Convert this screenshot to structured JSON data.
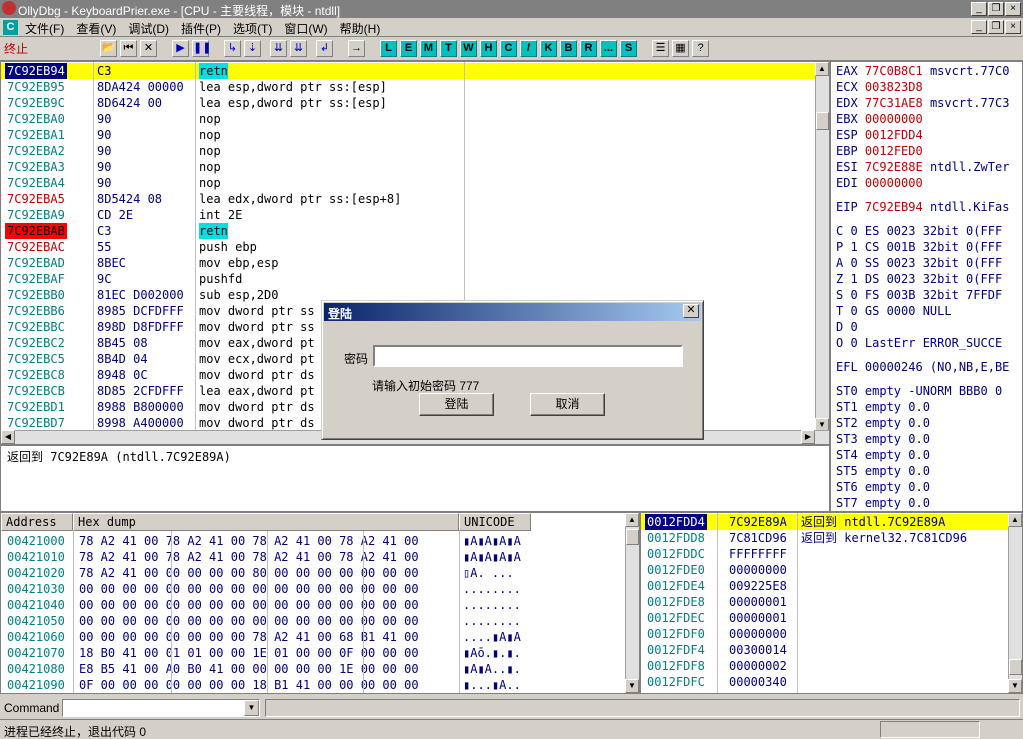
{
  "window": {
    "title": "OllyDbg - KeyboardPrier.exe - [CPU - 主要线程，模块 - ntdll]"
  },
  "menu": [
    "文件(F)",
    "查看(V)",
    "调试(D)",
    "插件(P)",
    "选项(T)",
    "窗口(W)",
    "帮助(H)"
  ],
  "toolbar": {
    "status": "终止",
    "letters": [
      "L",
      "E",
      "M",
      "T",
      "W",
      "H",
      "C",
      "/",
      "K",
      "B",
      "R",
      "...",
      "S"
    ]
  },
  "cpu": {
    "rows": [
      {
        "addr": "7C92EB94",
        "hex": "C3",
        "dis": "retn",
        "style": "sel",
        "hl": true
      },
      {
        "addr": "7C92EB95",
        "hex": "8DA424 00000",
        "dis": "lea esp,dword ptr ss:[esp]"
      },
      {
        "addr": "7C92EB9C",
        "hex": "8D6424 00",
        "dis": "lea esp,dword ptr ss:[esp]"
      },
      {
        "addr": "7C92EBA0",
        "hex": "90",
        "dis": "nop"
      },
      {
        "addr": "7C92EBA1",
        "hex": "90",
        "dis": "nop"
      },
      {
        "addr": "7C92EBA2",
        "hex": "90",
        "dis": "nop"
      },
      {
        "addr": "7C92EBA3",
        "hex": "90",
        "dis": "nop"
      },
      {
        "addr": "7C92EBA4",
        "hex": "90",
        "dis": "nop"
      },
      {
        "addr": "7C92EBA5",
        "hex": "8D5424 08",
        "dis": "lea edx,dword ptr ss:[esp+8]",
        "style": "red"
      },
      {
        "addr": "7C92EBA9",
        "hex": "CD 2E",
        "dis": "int 2E"
      },
      {
        "addr": "7C92EBAB",
        "hex": "C3",
        "dis": "retn",
        "style": "bp",
        "hl": true
      },
      {
        "addr": "7C92EBAC",
        "hex": "55",
        "dis": "push ebp",
        "style": "red"
      },
      {
        "addr": "7C92EBAD",
        "hex": "8BEC",
        "dis": "mov ebp,esp"
      },
      {
        "addr": "7C92EBAF",
        "hex": "9C",
        "dis": "pushfd"
      },
      {
        "addr": "7C92EBB0",
        "hex": "81EC D002000",
        "dis": "sub esp,2D0"
      },
      {
        "addr": "7C92EBB6",
        "hex": "8985 DCFDFFF",
        "dis": "mov dword ptr ss"
      },
      {
        "addr": "7C92EBBC",
        "hex": "898D D8FDFFF",
        "dis": "mov dword ptr ss"
      },
      {
        "addr": "7C92EBC2",
        "hex": "8B45 08",
        "dis": "mov eax,dword pt"
      },
      {
        "addr": "7C92EBC5",
        "hex": "8B4D 04",
        "dis": "mov ecx,dword pt"
      },
      {
        "addr": "7C92EBC8",
        "hex": "8948 0C",
        "dis": "mov dword ptr ds"
      },
      {
        "addr": "7C92EBCB",
        "hex": "8D85 2CFDFFF",
        "dis": "lea eax,dword pt"
      },
      {
        "addr": "7C92EBD1",
        "hex": "8988 B800000",
        "dis": "mov dword ptr ds"
      },
      {
        "addr": "7C92EBD7",
        "hex": "8998 A400000",
        "dis": "mov dword ptr ds"
      }
    ]
  },
  "info": {
    "line": "返回到 7C92E89A (ntdll.7C92E89A)"
  },
  "registers": [
    {
      "n": "EAX",
      "v": "77C0B8C1",
      "c": "msvcrt.77C0"
    },
    {
      "n": "ECX",
      "v": "003823D8",
      "c": ""
    },
    {
      "n": "EDX",
      "v": "77C31AE8",
      "c": "msvcrt.77C3"
    },
    {
      "n": "EBX",
      "v": "00000000",
      "c": ""
    },
    {
      "n": "ESP",
      "v": "0012FDD4",
      "c": ""
    },
    {
      "n": "EBP",
      "v": "0012FED0",
      "c": ""
    },
    {
      "n": "ESI",
      "v": "7C92E88E",
      "c": "ntdll.ZwTer"
    },
    {
      "n": "EDI",
      "v": "00000000",
      "c": ""
    },
    {
      "n": "EIP",
      "v": "7C92EB94",
      "c": "ntdll.KiFas"
    }
  ],
  "flags": [
    "C 0  ES 0023 32bit 0(FFF",
    "P 1  CS 001B 32bit 0(FFF",
    "A 0  SS 0023 32bit 0(FFF",
    "Z 1  DS 0023 32bit 0(FFF",
    "S 0  FS 003B 32bit 7FFDF",
    "T 0  GS 0000 NULL",
    "D 0",
    "O 0  LastErr ERROR_SUCCE"
  ],
  "efl": "EFL 00000246 (NO,NB,E,BE",
  "fpu": [
    "ST0 empty -UNORM BBB0 0",
    "ST1 empty 0.0",
    "ST2 empty 0.0",
    "ST3 empty 0.0",
    "ST4 empty 0.0",
    "ST5 empty 0.0",
    "ST6 empty 0.0",
    "ST7 empty 0.0"
  ],
  "dump": {
    "headers": [
      "Address",
      "Hex dump",
      "UNICODE"
    ],
    "rows": [
      {
        "a": "00421000",
        "h": "78 A2 41 00|78 A2 41 00|78 A2 41 00|78 A2 41 00",
        "u": "▮A▮A▮A▮A"
      },
      {
        "a": "00421010",
        "h": "78 A2 41 00|78 A2 41 00|78 A2 41 00|78 A2 41 00",
        "u": "▮A▮A▮A▮A"
      },
      {
        "a": "00421020",
        "h": "78 A2 41 00|00 00 00 00|80 00 00 00|00 00 00 00",
        "u": "▯A.  ..."
      },
      {
        "a": "00421030",
        "h": "00 00 00 00|00 00 00 00|00 00 00 00|00 00 00 00",
        "u": "........"
      },
      {
        "a": "00421040",
        "h": "00 00 00 00|00 00 00 00|00 00 00 00|00 00 00 00",
        "u": "........"
      },
      {
        "a": "00421050",
        "h": "00 00 00 00|00 00 00 00|00 00 00 00|00 00 00 00",
        "u": "........"
      },
      {
        "a": "00421060",
        "h": "00 00 00 00|00 00 00 00|78 A2 41 00|68 B1 41 00",
        "u": "....▮A▮A"
      },
      {
        "a": "00421070",
        "h": "18 B0 41 00|01 01 00 00|1E 01 00 00|0F 00 00 00",
        "u": "▮Aō.▮.▮."
      },
      {
        "a": "00421080",
        "h": "E8 B5 41 00|A0 B0 41 00|00 00 00 00|1E 00 00 00",
        "u": "▮A▮A..▮."
      },
      {
        "a": "00421090",
        "h": "0F 00 00 00|00 00 00 00|18 B1 41 00|00 00 00 00",
        "u": "▮...▮A.."
      }
    ]
  },
  "stack": {
    "rows": [
      {
        "a": "0012FDD4",
        "v": "7C92E89A",
        "c": "返回到 ntdll.7C92E89A",
        "sel": true
      },
      {
        "a": "0012FDD8",
        "v": "7C81CD96",
        "c": "返回到 kernel32.7C81CD96"
      },
      {
        "a": "0012FDDC",
        "v": "FFFFFFFF",
        "c": ""
      },
      {
        "a": "0012FDE0",
        "v": "00000000",
        "c": ""
      },
      {
        "a": "0012FDE4",
        "v": "009225E8",
        "c": ""
      },
      {
        "a": "0012FDE8",
        "v": "00000001",
        "c": ""
      },
      {
        "a": "0012FDEC",
        "v": "00000001",
        "c": ""
      },
      {
        "a": "0012FDF0",
        "v": "00000000",
        "c": ""
      },
      {
        "a": "0012FDF4",
        "v": "00300014",
        "c": ""
      },
      {
        "a": "0012FDF8",
        "v": "00000002",
        "c": ""
      },
      {
        "a": "0012FDFC",
        "v": "00000340",
        "c": ""
      }
    ]
  },
  "command": {
    "label": "Command :"
  },
  "status": {
    "text": "进程已经终止，退出代码 0"
  },
  "dialog": {
    "title": "登陆",
    "label": "密码",
    "value": "",
    "hint": "请输入初始密码 777",
    "ok": "登陆",
    "cancel": "取消"
  }
}
